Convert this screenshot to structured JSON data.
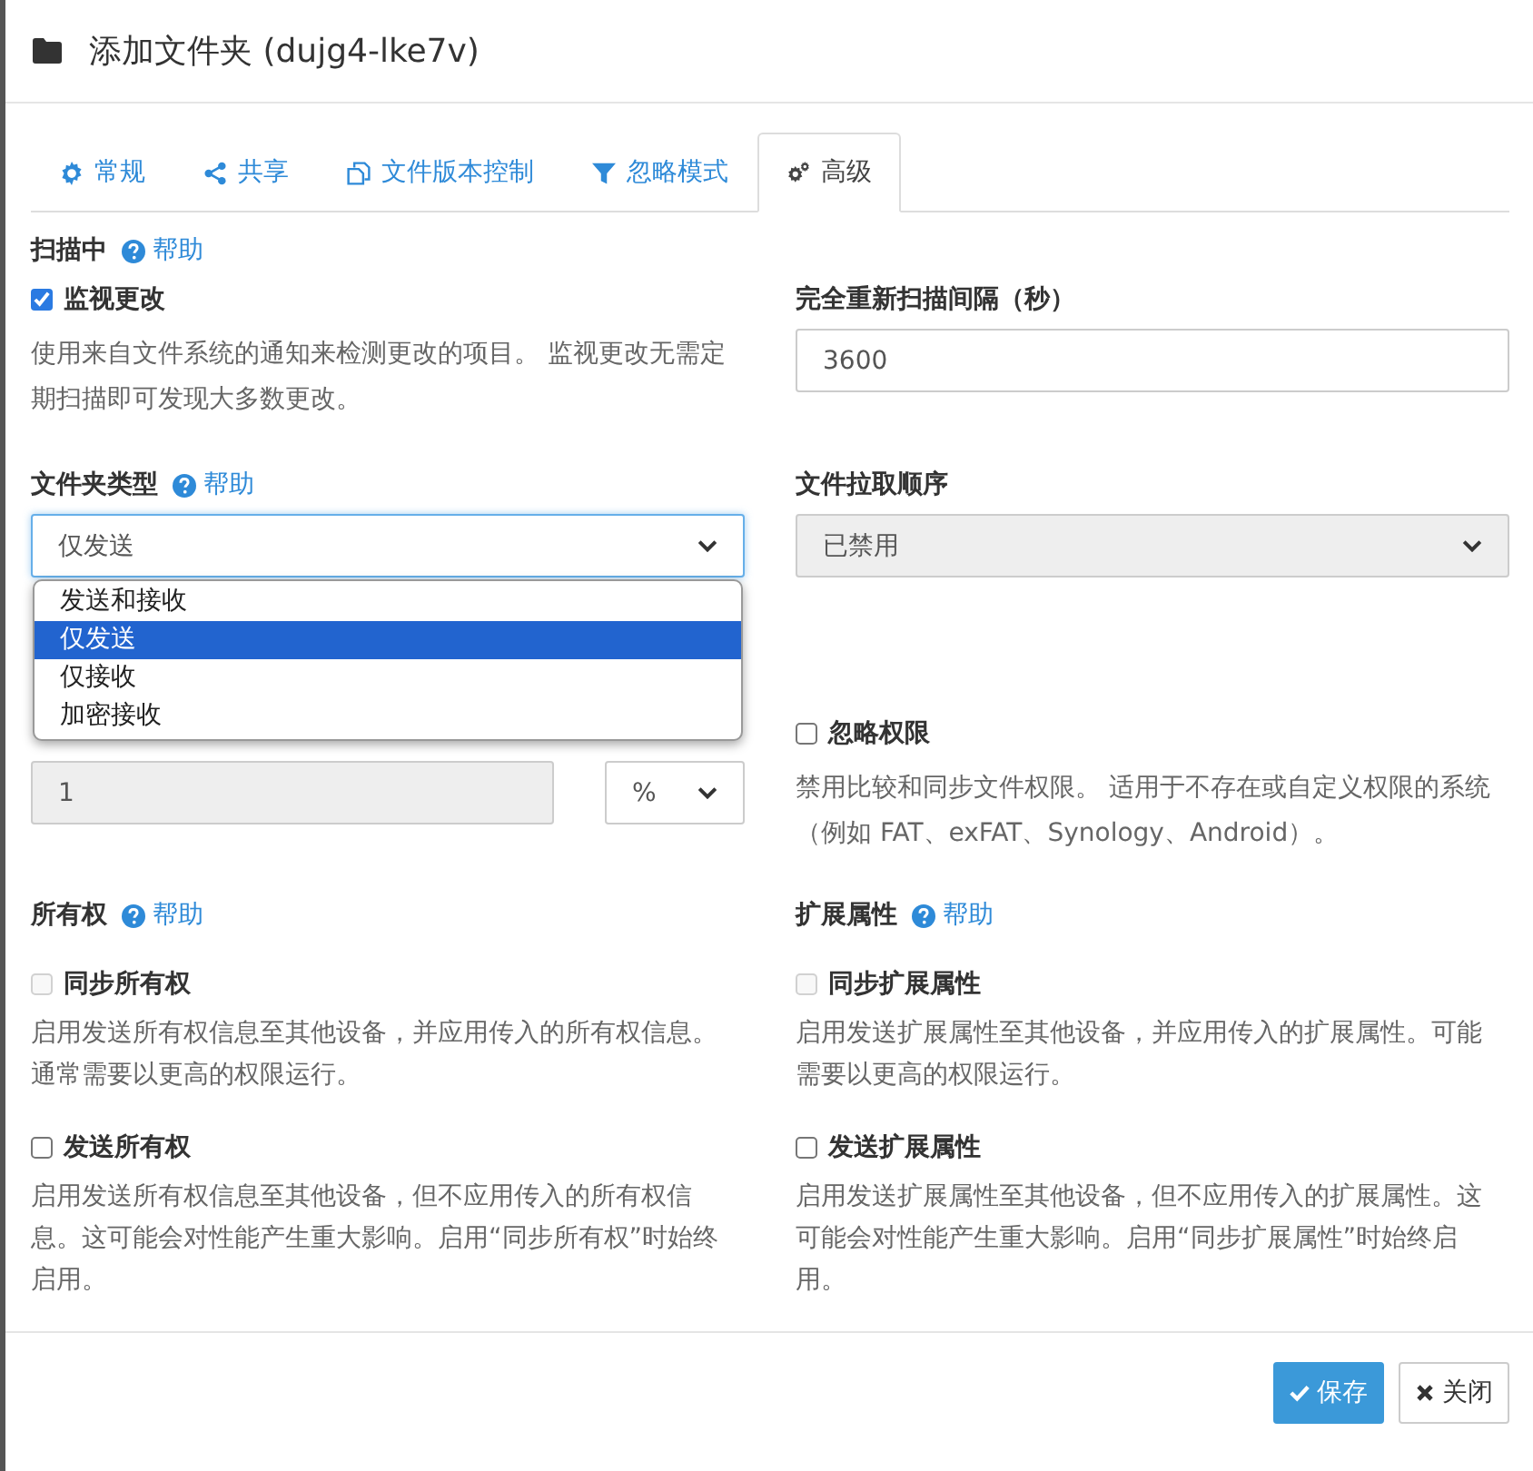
{
  "dialog": {
    "title": "添加文件夹 (dujg4-lke7v)"
  },
  "tabs": [
    {
      "label": "常规",
      "selected": false
    },
    {
      "label": "共享",
      "selected": false
    },
    {
      "label": "文件版本控制",
      "selected": false
    },
    {
      "label": "忽略模式",
      "selected": false
    },
    {
      "label": "高级",
      "selected": true
    }
  ],
  "scanning": {
    "heading": "扫描中",
    "help": "帮助",
    "watch": {
      "label": "监视更改",
      "checked": true
    },
    "watch_description": "使用来自文件系统的通知来检测更改的项目。 监视更改无需定期扫描即可发现大多数更改。",
    "rescan_label": "完全重新扫描间隔（秒）",
    "rescan_value": "3600"
  },
  "folder_type": {
    "label": "文件夹类型",
    "help": "帮助",
    "value": "仅发送",
    "expanded": true,
    "options": [
      {
        "label": "发送和接收",
        "selected": false
      },
      {
        "label": "仅发送",
        "selected": true
      },
      {
        "label": "仅接收",
        "selected": false
      },
      {
        "label": "加密接收",
        "selected": false
      }
    ]
  },
  "pull_order": {
    "label": "文件拉取顺序",
    "value": "已禁用",
    "disabled": true
  },
  "min_disk_free": {
    "value": "1",
    "unit": "%",
    "disabled": true
  },
  "ignore_perms": {
    "label": "忽略权限",
    "checked": false,
    "description": "禁用比较和同步文件权限。 适用于不存在或自定义权限的系统（例如 FAT、exFAT、Synology、Android）。"
  },
  "groups": [
    {
      "heading": "所有权",
      "help": "帮助",
      "options": [
        {
          "label": "同步所有权",
          "checked": false,
          "disabled": true,
          "description": "启用发送所有权信息至其他设备，并应用传入的所有权信息。通常需要以更高的权限运行。"
        },
        {
          "label": "发送所有权",
          "checked": false,
          "disabled": false,
          "description": "启用发送所有权信息至其他设备，但不应用传入的所有权信息。这可能会对性能产生重大影响。启用“同步所有权”时始终启用。"
        }
      ]
    },
    {
      "heading": "扩展属性",
      "help": "帮助",
      "options": [
        {
          "label": "同步扩展属性",
          "checked": false,
          "disabled": true,
          "description": "启用发送扩展属性至其他设备，并应用传入的扩展属性。可能需要以更高的权限运行。"
        },
        {
          "label": "发送扩展属性",
          "checked": false,
          "disabled": false,
          "description": "启用发送扩展属性至其他设备，但不应用传入的扩展属性。这可能会对性能产生重大影响。启用“同步扩展属性”时始终启用。"
        }
      ]
    }
  ],
  "buttons": [
    {
      "label": "保存",
      "kind": "primary"
    },
    {
      "label": "关闭",
      "kind": "default"
    }
  ]
}
